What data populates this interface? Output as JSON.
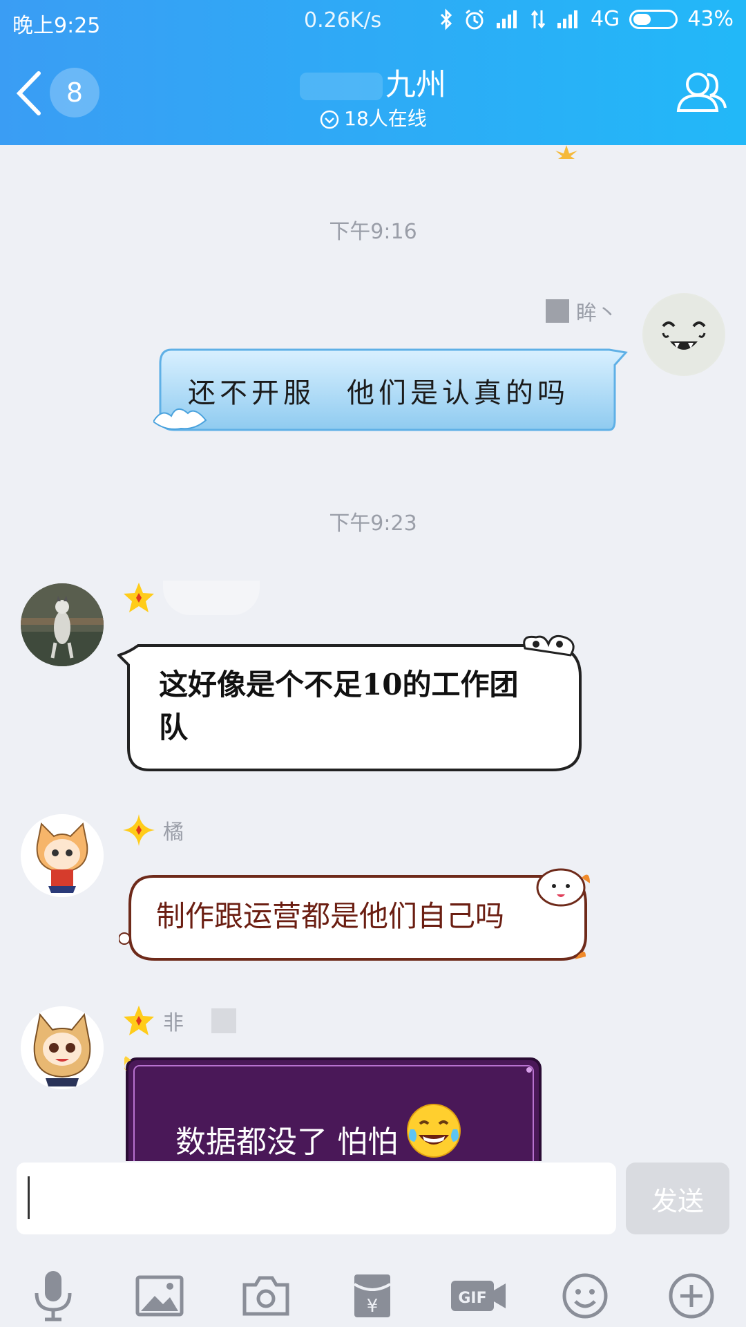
{
  "status": {
    "time": "晚上9:25",
    "speed": "0.26K/s",
    "network": "4G",
    "battery": "43%",
    "battery_level": 0.43
  },
  "header": {
    "unread_count": "8",
    "title": "九州",
    "online_status": "18人在线"
  },
  "chat": {
    "timestamps": [
      "下午9:16",
      "下午9:23"
    ],
    "messages": [
      {
        "sender": "眸丶",
        "text": "还不开服　他们是认真的吗",
        "side": "right"
      },
      {
        "sender": "",
        "text_line1": "这好像是个不足10的工作团",
        "text_line2": "队",
        "side": "left"
      },
      {
        "sender": "橘",
        "text": "制作跟运营都是他们自己吗",
        "side": "left"
      },
      {
        "sender": "非",
        "text": "数据都没了  怕怕",
        "side": "left"
      }
    ]
  },
  "input": {
    "value": "",
    "send_label": "发送"
  },
  "toolbar": {
    "items": [
      "mic-icon",
      "image-icon",
      "camera-icon",
      "red-packet-icon",
      "gif-icon",
      "emoji-icon",
      "plus-icon"
    ]
  },
  "colors": {
    "header_start": "#3a9df4",
    "header_end": "#22b8f8",
    "chat_bg": "#eef0f5",
    "purple_bubble": "#4a1858"
  }
}
